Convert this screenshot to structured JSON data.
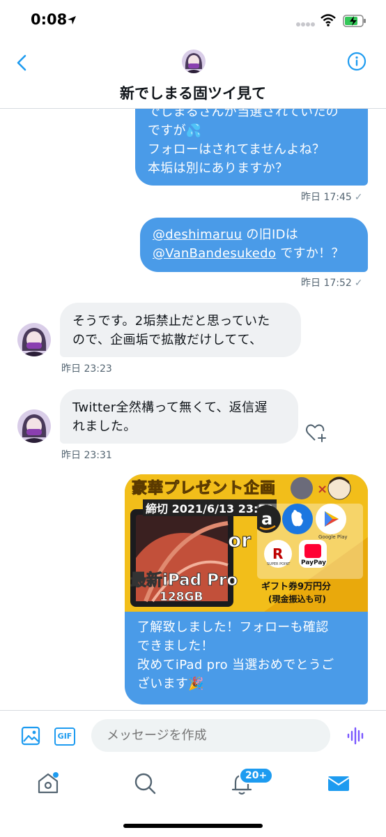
{
  "status_bar": {
    "time": "0:08"
  },
  "header": {
    "title": "新でしまる固ツイ見て"
  },
  "messages": [
    {
      "lines": [
        "でしまるさんが当選されていたの",
        "ですが💦",
        "フォローはされてませんよね？",
        "本垢は別にありますか？"
      ],
      "time": "昨日 17:45"
    },
    {
      "link1": "@deshimaruu",
      "text1": " の旧IDは",
      "link2": "@VanBandesukedo",
      "text2": " ですか！？",
      "time": "昨日 17:52"
    },
    {
      "lines": [
        "そうです。2垢禁止だと思っていた",
        "ので、企画垢で拡散だけしてて、"
      ],
      "time": "昨日 23:23"
    },
    {
      "lines": [
        "Twitter全然構って無くて、返信遅",
        "れました。"
      ],
      "time": "昨日 23:31"
    },
    {
      "lines": [
        "了解致しました！フォローも確認",
        "できました！",
        "改めてiPad pro 当選おめでとうご",
        "ざいます🎉"
      ]
    }
  ],
  "promo_image": {
    "title": "豪華プレゼント企画",
    "deadline": "締切 2021/6/13 23:59",
    "or": "or",
    "latest": "最新iPad Pro",
    "capacity": "128GB",
    "gift": "ギフト券9万円分",
    "cash": "(現金振込も可)",
    "google_play": "Google Play",
    "super_point": "SUPER POINT",
    "paypay": "PayPay"
  },
  "composer": {
    "placeholder": "メッセージを作成",
    "gif_label": "GIF"
  },
  "tabbar": {
    "badge": "20+"
  },
  "colors": {
    "accent": "#1d9bf0",
    "bubble_out": "#4a9be8",
    "bubble_in": "#eff1f3"
  }
}
